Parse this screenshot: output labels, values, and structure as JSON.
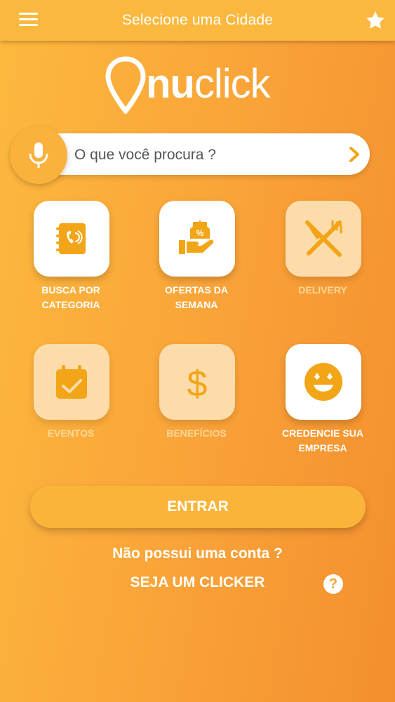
{
  "header": {
    "title": "Selecione uma Cidade",
    "menu_icon": "hamburger-menu-icon",
    "favorite_icon": "star-icon"
  },
  "logo": {
    "text_bold": "nu",
    "text_light": "click"
  },
  "search": {
    "placeholder": "O que você procura ?",
    "mic_icon": "microphone-icon",
    "go_icon": "chevron-right-icon"
  },
  "tiles": [
    {
      "line1": "BUSCA POR",
      "line2": "CATEGORIA",
      "icon": "phone-book-icon",
      "enabled": true
    },
    {
      "line1": "OFERTAS DA",
      "line2": "SEMANA",
      "icon": "hand-offer-icon",
      "enabled": true
    },
    {
      "line1": "DELIVERY",
      "line2": "",
      "icon": "fork-knife-icon",
      "enabled": false
    },
    {
      "line1": "EVENTOS",
      "line2": "",
      "icon": "calendar-check-icon",
      "enabled": false
    },
    {
      "line1": "BENEFÍCIOS",
      "line2": "",
      "icon": "dollar-icon",
      "enabled": false
    },
    {
      "line1": "CREDENCIE SUA",
      "line2": "EMPRESA",
      "icon": "smiley-icon",
      "enabled": true
    }
  ],
  "actions": {
    "enter_label": "ENTRAR",
    "no_account_text": "Não possui uma conta ?",
    "signup_label": "SEJA UM CLICKER",
    "help_glyph": "?"
  },
  "colors": {
    "accent": "#fbb83f",
    "icon_orange": "#f2a516",
    "disabled_tile": "#fcdcab",
    "disabled_label": "#fcd79a"
  }
}
